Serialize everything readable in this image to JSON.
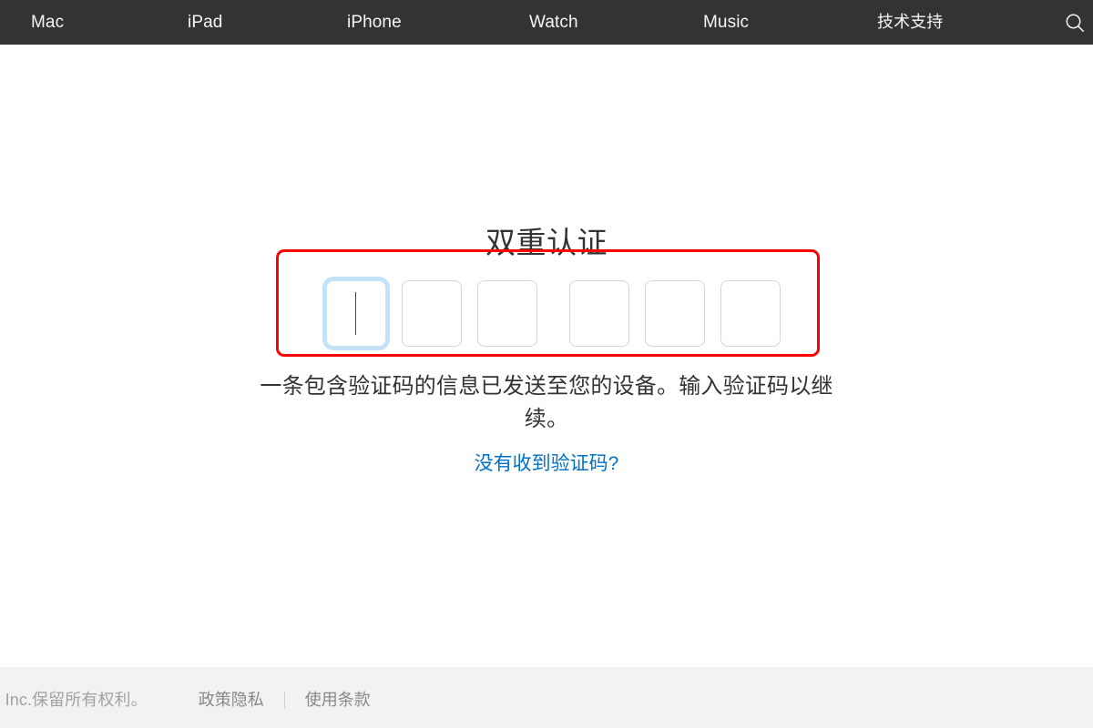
{
  "nav": {
    "background": "#333333",
    "items": [
      {
        "label": "Mac",
        "name": "nav-item-mac"
      },
      {
        "label": "iPad",
        "name": "nav-item-ipad"
      },
      {
        "label": "iPhone",
        "name": "nav-item-iphone"
      },
      {
        "label": "Watch",
        "name": "nav-item-watch"
      },
      {
        "label": "Music",
        "name": "nav-item-music"
      },
      {
        "label": "技术支持",
        "name": "nav-item-support"
      }
    ],
    "search_icon": "search-icon"
  },
  "main": {
    "title": "双重认证",
    "instructions": "一条包含验证码的信息已发送至您的设备。输入验证码以继续。",
    "help_link": "没有收到验证码?",
    "code_entry": {
      "digit_count": 6,
      "values": [
        "",
        "",
        "",
        "",
        "",
        ""
      ],
      "focused_index": 0,
      "caret_visible": true,
      "focus_ring_color": "#c3e1f7",
      "border_color": "#d6d6d6"
    },
    "annotation": {
      "shape": "rectangle",
      "color": "#fd0000",
      "stroke_width": 3
    },
    "link_color": "#0070c9"
  },
  "footer": {
    "copyright": "Apple Inc.保留所有权利。",
    "links": [
      {
        "label": "政策隐私",
        "name": "footer-link-privacy"
      },
      {
        "label": "使用条款",
        "name": "footer-link-terms"
      }
    ],
    "background": "#f2f2f2"
  }
}
